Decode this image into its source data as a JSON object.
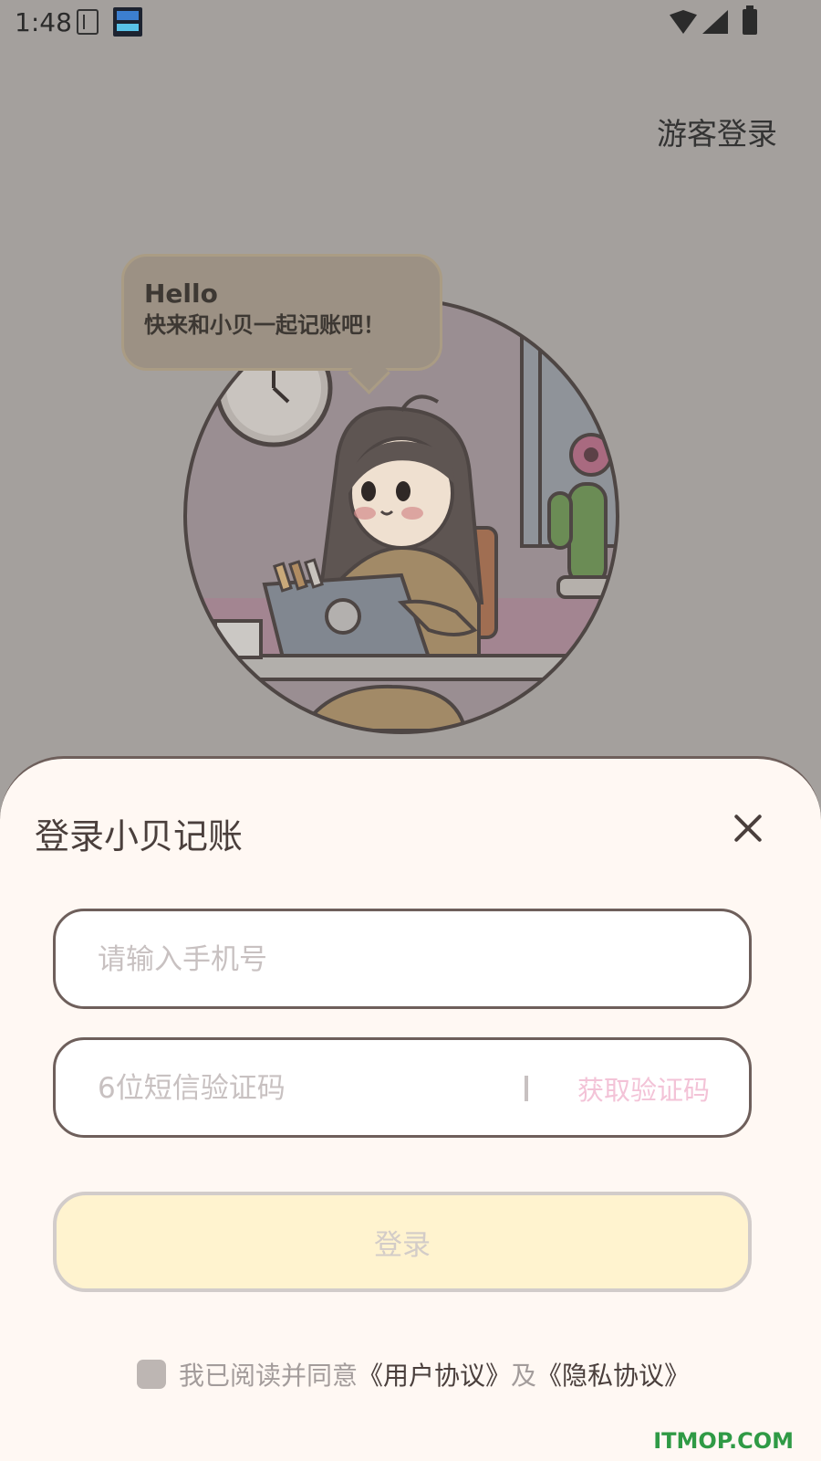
{
  "status_bar": {
    "time": "1:48",
    "icons": [
      "sim-card-icon",
      "app-notification-icon",
      "wifi-icon",
      "signal-icon",
      "battery-icon"
    ]
  },
  "header": {
    "guest_login": "游客登录"
  },
  "illustration": {
    "greeting": "Hello",
    "message": "快来和小贝一起记账吧！"
  },
  "sheet": {
    "title": "登录小贝记账",
    "phone_placeholder": "请输入手机号",
    "code_placeholder": "6位短信验证码",
    "get_code_label": "获取验证码",
    "login_label": "登录",
    "agreement": {
      "prefix": "我已阅读并同意",
      "user_agreement": "《用户协议》",
      "and": "及",
      "privacy_agreement": "《隐私协议》"
    }
  },
  "watermark": "ITMOP.COM",
  "colors": {
    "sheet_bg": "#fff8f3",
    "login_bg": "#fff3cf",
    "get_code_color": "#f3c3d7",
    "overlay_bg": "#a4a09d"
  }
}
